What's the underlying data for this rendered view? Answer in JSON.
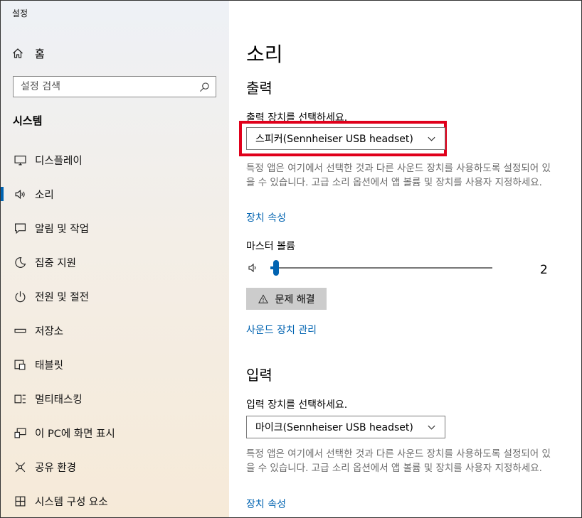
{
  "app": {
    "title": "설정"
  },
  "sidebar": {
    "home_label": "홈",
    "search_placeholder": "설정 검색",
    "section": "시스템",
    "items": [
      {
        "label": "디스플레이",
        "icon": "monitor-icon"
      },
      {
        "label": "소리",
        "icon": "speaker-icon",
        "active": true
      },
      {
        "label": "알림 및 작업",
        "icon": "notification-icon"
      },
      {
        "label": "집중 지원",
        "icon": "moon-icon"
      },
      {
        "label": "전원 및 절전",
        "icon": "power-icon"
      },
      {
        "label": "저장소",
        "icon": "storage-icon"
      },
      {
        "label": "태블릿",
        "icon": "tablet-icon"
      },
      {
        "label": "멀티태스킹",
        "icon": "multitasking-icon"
      },
      {
        "label": "이 PC에 화면 표시",
        "icon": "project-icon"
      },
      {
        "label": "공유 환경",
        "icon": "share-icon"
      },
      {
        "label": "시스템 구성 요소",
        "icon": "components-icon"
      }
    ]
  },
  "main": {
    "title": "소리",
    "output": {
      "heading": "출력",
      "device_label": "출력 장치를 선택하세요.",
      "device_value": "스피커(Sennheiser USB headset)",
      "description": "특정 앱은 여기에서 선택한 것과 다른 사운드 장치를 사용하도록 설정되어 있을 수 있습니다. 고급 소리 옵션에서 앱 볼륨 및 장치를 사용자 지정하세요.",
      "properties_link": "장치 속성",
      "master_volume_label": "마스터 볼륨",
      "master_volume_value": "2",
      "troubleshoot_label": "문제 해결",
      "manage_link": "사운드 장치 관리"
    },
    "input": {
      "heading": "입력",
      "device_label": "입력 장치를 선택하세요.",
      "device_value": "마이크(Sennheiser USB headset)",
      "description": "특정 앱은 여기에서 선택한 것과 다른 사운드 장치를 사용하도록 설정되어 있을 수 있습니다. 고급 소리 옵션에서 앱 볼륨 및 장치를 사용자 지정하세요.",
      "properties_link": "장치 속성"
    }
  },
  "colors": {
    "accent": "#0063b1",
    "highlight": "#e0001b"
  }
}
